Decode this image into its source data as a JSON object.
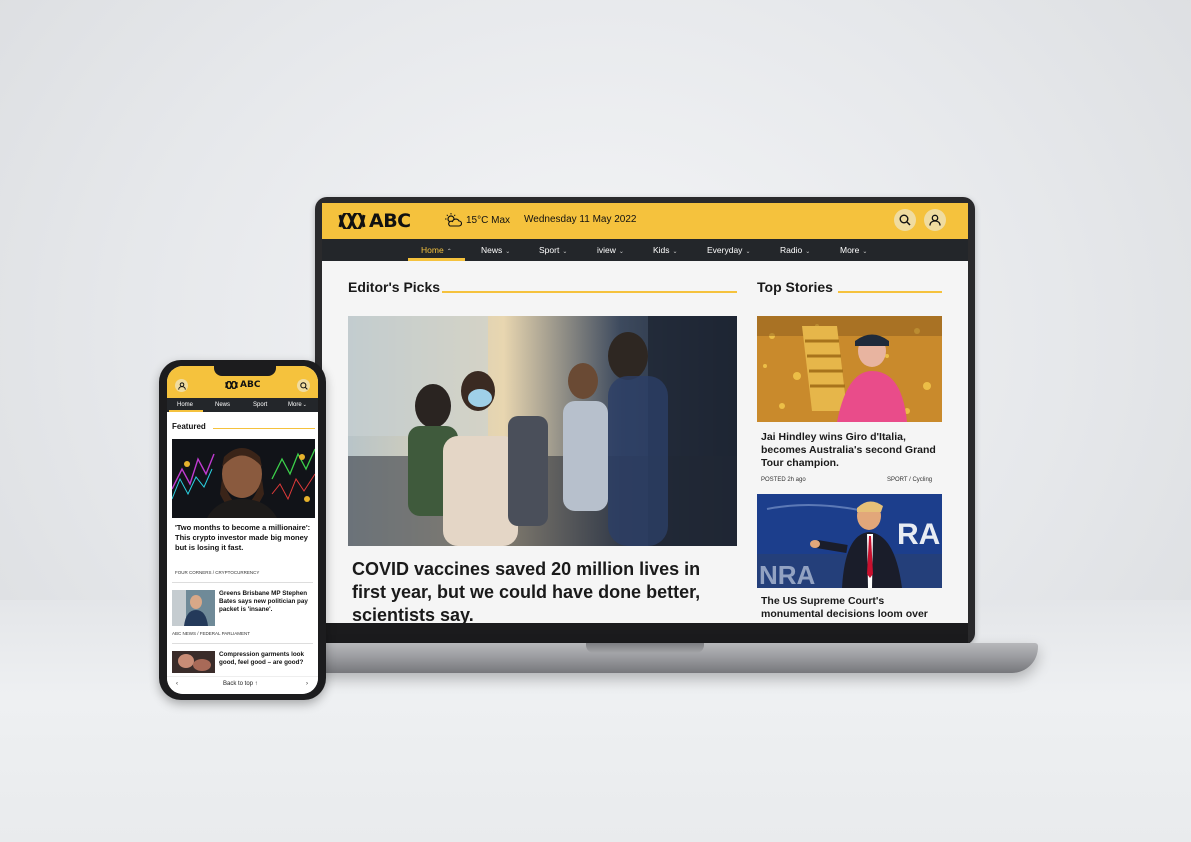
{
  "desktop": {
    "brand": "ABC",
    "weather": {
      "icon": "partly-cloudy-icon",
      "label": "15°C Max"
    },
    "date": "Wednesday 11 May 2022",
    "nav": [
      {
        "label": "Home",
        "active": true
      },
      {
        "label": "News"
      },
      {
        "label": "Sport"
      },
      {
        "label": "iview"
      },
      {
        "label": "Kids"
      },
      {
        "label": "Everyday"
      },
      {
        "label": "Radio"
      },
      {
        "label": "More"
      }
    ],
    "editors_picks": {
      "title": "Editor's Picks",
      "headline": "COVID vaccines saved 20 million lives in first year, but we could have done better, scientists say."
    },
    "top_stories": {
      "title": "Top Stories",
      "items": [
        {
          "headline": "Jai Hindley wins Giro d'Italia, becomes Australia's second Grand Tour champion.",
          "posted": "POSTED 2h ago",
          "category": "SPORT / Cycling"
        },
        {
          "headline": "The US Supreme Court's monumental decisions loom over"
        }
      ]
    }
  },
  "mobile": {
    "brand": "ABC",
    "nav": [
      {
        "label": "Home",
        "active": true
      },
      {
        "label": "News"
      },
      {
        "label": "Sport"
      },
      {
        "label": "More"
      }
    ],
    "section_title": "Featured",
    "featured": {
      "headline": "'Two months to become a millionaire': This crypto investor made big money but is losing it fast.",
      "meta": "FOUR CORNERS / CRYPTOCURRENCY"
    },
    "stories": [
      {
        "headline": "Greens Brisbane MP Stephen Bates says new politician pay packet is 'insane'.",
        "meta": "ABC NEWS / FEDERAL PARLIAMENT"
      },
      {
        "headline": "Compression garments look good, feel good – are good?"
      }
    ],
    "back_to_top": "Back to top ↑"
  },
  "colors": {
    "brand_yellow": "#f5c23d",
    "nav_dark": "#23262a"
  }
}
